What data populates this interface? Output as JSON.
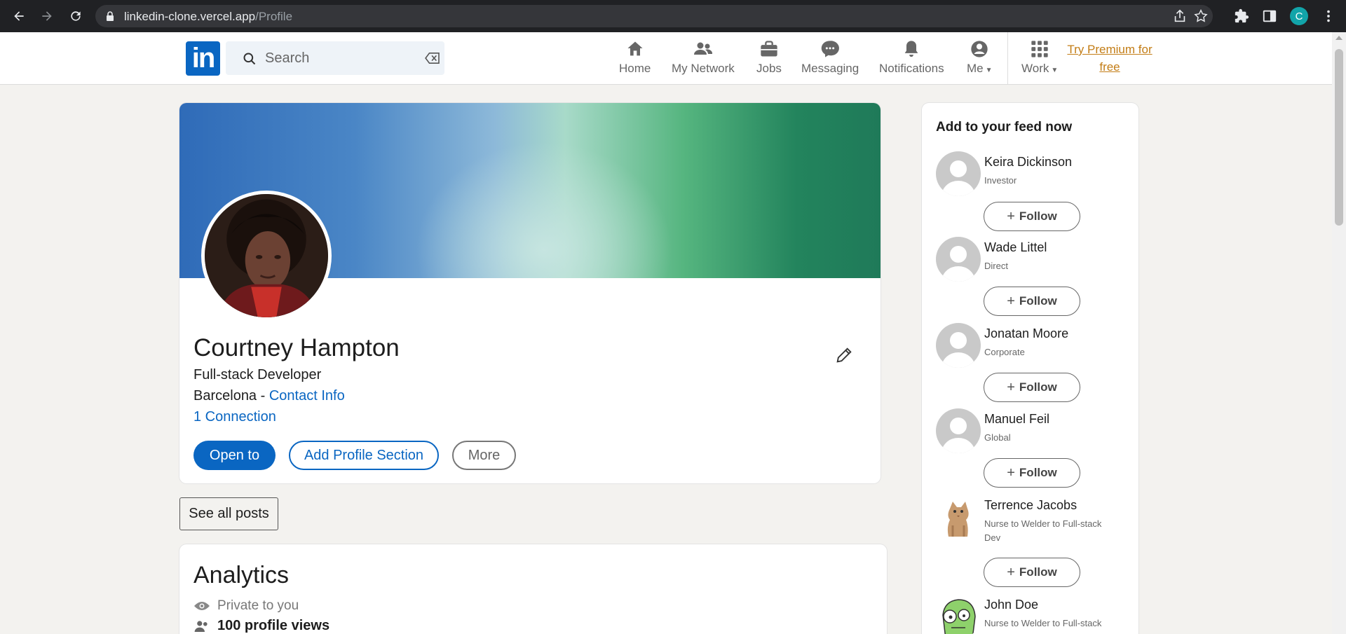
{
  "browser": {
    "url_host": "linkedin-clone.vercel.app",
    "url_path": "/Profile",
    "profile_initial": "C"
  },
  "header": {
    "logo_text": "in",
    "search_placeholder": "Search",
    "nav": [
      {
        "label": "Home",
        "icon": "home-icon"
      },
      {
        "label": "My Network",
        "icon": "network-icon"
      },
      {
        "label": "Jobs",
        "icon": "briefcase-icon"
      },
      {
        "label": "Messaging",
        "icon": "messaging-icon"
      },
      {
        "label": "Notifications",
        "icon": "bell-icon"
      },
      {
        "label": "Me",
        "icon": "user-circle-icon"
      },
      {
        "label": "Work",
        "icon": "grid-icon"
      }
    ],
    "premium_line1": "Try Premium for",
    "premium_line2": "free"
  },
  "profile": {
    "name": "Courtney Hampton",
    "headline": "Full-stack Developer",
    "location": "Barcelona",
    "location_separator": " - ",
    "contact_info": "Contact Info",
    "connections": "1 Connection",
    "buttons": {
      "open_to": "Open to",
      "add_section": "Add Profile Section",
      "more": "More"
    }
  },
  "posts": {
    "see_all": "See all posts"
  },
  "analytics": {
    "title": "Analytics",
    "private": "Private to you",
    "views": "100 profile views"
  },
  "feed": {
    "title": "Add to your feed now",
    "follow_label": "Follow",
    "people": [
      {
        "name": "Keira Dickinson",
        "role": "Investor"
      },
      {
        "name": "Wade Littel",
        "role": "Direct"
      },
      {
        "name": "Jonatan Moore",
        "role": "Corporate"
      },
      {
        "name": "Manuel Feil",
        "role": "Global"
      },
      {
        "name": "Terrence Jacobs",
        "role": "Nurse to Welder to Full-stack Dev"
      },
      {
        "name": "John Doe",
        "role": "Nurse to Welder to Full-stack"
      }
    ]
  },
  "colors": {
    "brand": "#0a66c2",
    "premium": "#c37d16",
    "page_bg": "#f3f2ef"
  }
}
